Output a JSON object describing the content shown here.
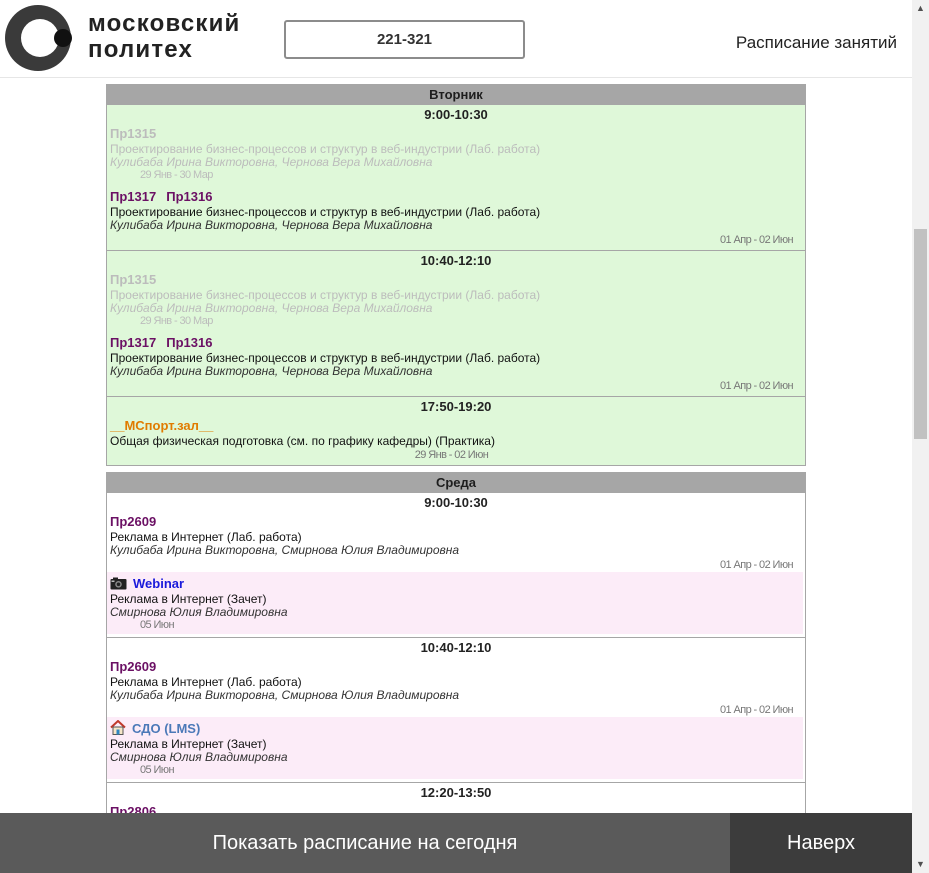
{
  "header": {
    "logo_line1": "московский",
    "logo_line2": "политех",
    "group": "221-321",
    "title": "Расписание занятий"
  },
  "days": [
    {
      "name": "Вторник",
      "pairs": [
        {
          "time": "9:00-10:30",
          "lessons": [
            {
              "rooms": [
                "Пр1315"
              ],
              "subject": "Проектирование бизнес-процессов и структур в веб-индустрии (Лаб. работа)",
              "teachers": "Кулибаба Ирина Викторовна, Чернова Вера Михайловна",
              "dates": "29 Янв - 30 Мар",
              "past": true
            },
            {
              "rooms": [
                "Пр1317",
                "Пр1316"
              ],
              "subject": "Проектирование бизнес-процессов и структур в веб-индустрии (Лаб. работа)",
              "teachers": "Кулибаба Ирина Викторовна, Чернова Вера Михайловна",
              "dates": "01 Апр - 02 Июн",
              "past": false
            }
          ]
        },
        {
          "time": "10:40-12:10",
          "lessons": [
            {
              "rooms": [
                "Пр1315"
              ],
              "subject": "Проектирование бизнес-процессов и структур в веб-индустрии (Лаб. работа)",
              "teachers": "Кулибаба Ирина Викторовна, Чернова Вера Михайловна",
              "dates": "29 Янв - 30 Мар",
              "past": true
            },
            {
              "rooms": [
                "Пр1317",
                "Пр1316"
              ],
              "subject": "Проектирование бизнес-процессов и структур в веб-индустрии (Лаб. работа)",
              "teachers": "Кулибаба Ирина Викторовна, Чернова Вера Михайловна",
              "dates": "01 Апр - 02 Июн",
              "past": false
            }
          ]
        },
        {
          "time": "17:50-19:20",
          "lessons": [
            {
              "rooms": [
                "__МСпорт.зал__"
              ],
              "subject": "Общая физическая подготовка (см. по графику кафедры) (Практика)",
              "teachers": "",
              "dates": "29 Янв - 02 Июн",
              "past": false
            }
          ]
        }
      ]
    },
    {
      "name": "Среда",
      "pairs": [
        {
          "time": "9:00-10:30",
          "lessons": [
            {
              "rooms": [
                "Пр2609"
              ],
              "subject": "Реклама в Интернет (Лаб. работа)",
              "teachers": "Кулибаба Ирина Викторовна, Смирнова Юлия Владимировна",
              "dates": "01 Апр - 02 Июн"
            },
            {
              "rooms": [
                "Webinar"
              ],
              "icon": "camera-icon",
              "subject": "Реклама в Интернет (Зачет)",
              "teachers": "Смирнова Юлия Владимировна",
              "dates": "05 Июн"
            }
          ]
        },
        {
          "time": "10:40-12:10",
          "lessons": [
            {
              "rooms": [
                "Пр2609"
              ],
              "subject": "Реклама в Интернет (Лаб. работа)",
              "teachers": "Кулибаба Ирина Викторовна, Смирнова Юлия Владимировна",
              "dates": "01 Апр - 02 Июн"
            },
            {
              "rooms": [
                "СДО (LMS)"
              ],
              "icon": "house-icon",
              "subject": "Реклама в Интернет (Зачет)",
              "teachers": "Смирнова Юлия Владимировна",
              "dates": "05 Июн"
            }
          ]
        },
        {
          "time": "12:20-13:50",
          "lessons": [
            {
              "rooms": [
                "Пр2806"
              ]
            }
          ]
        }
      ]
    }
  ],
  "footer": {
    "today_button": "Показать расписание на сегодня",
    "top_button": "Наверх"
  },
  "colors": {
    "room": "#6b1064",
    "sport_room": "#e07b00",
    "webinar": "#1a1adb",
    "lms": "#4b79b8",
    "past_day_bg": "#dff8d9",
    "online_bg": "#fcecf8",
    "header_bar": "#a6a6a6"
  }
}
